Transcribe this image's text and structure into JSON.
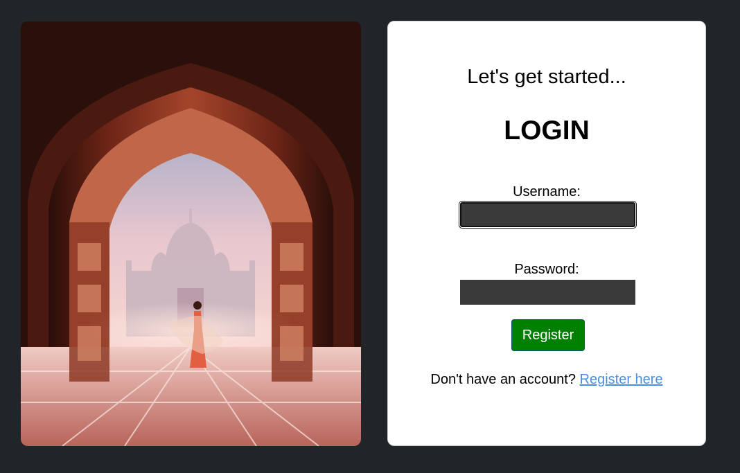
{
  "photo": {
    "alt": "Woman in red dress dancing under an arched gateway framing the Taj Mahal"
  },
  "login": {
    "tagline": "Let's get started...",
    "title": "LOGIN",
    "username_label": "Username:",
    "username_value": "",
    "password_label": "Password:",
    "password_value": "",
    "submit_label": "Register",
    "signup_prompt": "Don't have an account?",
    "signup_link": "Register here"
  },
  "colors": {
    "page_background": "#212529",
    "card_background": "#ffffff",
    "input_background": "#3a3a3a",
    "button_background": "#008000",
    "link": "#4a90e2"
  }
}
